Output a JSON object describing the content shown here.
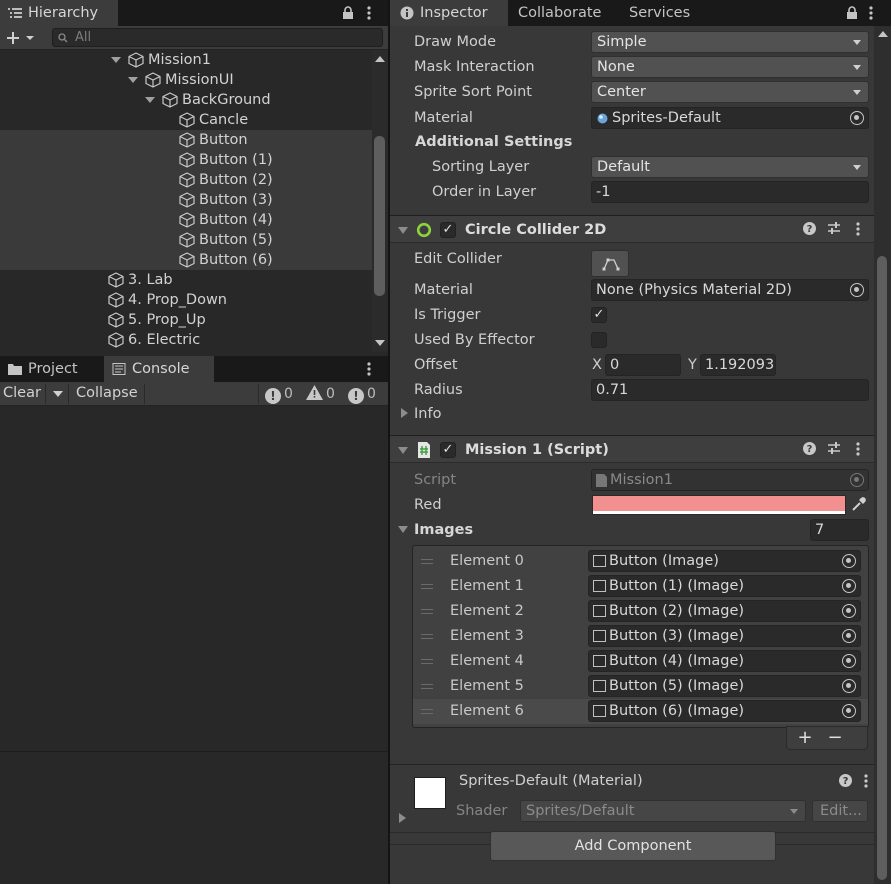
{
  "hierarchy": {
    "tab_label": "Hierarchy",
    "search_placeholder": "All",
    "items": [
      {
        "label": "Mission1",
        "depth": 0
      },
      {
        "label": "MissionUI",
        "depth": 1
      },
      {
        "label": "BackGround",
        "depth": 2
      },
      {
        "label": "Cancle",
        "depth": 3
      },
      {
        "label": "Button",
        "depth": 3
      },
      {
        "label": "Button (1)",
        "depth": 3
      },
      {
        "label": "Button (2)",
        "depth": 3
      },
      {
        "label": "Button (3)",
        "depth": 3
      },
      {
        "label": "Button (4)",
        "depth": 3
      },
      {
        "label": "Button (5)",
        "depth": 3
      },
      {
        "label": "Button (6)",
        "depth": 3
      },
      {
        "label": "3. Lab",
        "depth": -1
      },
      {
        "label": "4. Prop_Down",
        "depth": -1
      },
      {
        "label": "5. Prop_Up",
        "depth": -1
      },
      {
        "label": "6. Electric",
        "depth": -1
      }
    ]
  },
  "console": {
    "tabs": [
      "Project",
      "Console"
    ],
    "clear_label": "Clear",
    "collapse_label": "Collapse",
    "counts": {
      "info": "0",
      "warning": "0",
      "error": "0"
    }
  },
  "inspector": {
    "tabs": [
      "Inspector",
      "Collaborate",
      "Services"
    ],
    "sprite_renderer": {
      "draw_mode_label": "Draw Mode",
      "draw_mode": "Simple",
      "mask_label": "Mask Interaction",
      "mask": "None",
      "sort_point_label": "Sprite Sort Point",
      "sort_point": "Center",
      "material_label": "Material",
      "material": "Sprites-Default",
      "additional_label": "Additional Settings",
      "sorting_layer_label": "Sorting Layer",
      "sorting_layer": "Default",
      "order_label": "Order in Layer",
      "order": "-1"
    },
    "circle_collider": {
      "title": "Circle Collider 2D",
      "edit_label": "Edit Collider",
      "material_label": "Material",
      "material": "None (Physics Material 2D)",
      "trigger_label": "Is Trigger",
      "trigger_checked": true,
      "effector_label": "Used By Effector",
      "effector_checked": false,
      "offset_label": "Offset",
      "offset_x_label": "X",
      "offset_x": "0",
      "offset_y_label": "Y",
      "offset_y": "1.192093",
      "radius_label": "Radius",
      "radius": "0.71",
      "info_label": "Info"
    },
    "mission_script": {
      "title": "Mission 1 (Script)",
      "script_label": "Script",
      "script": "Mission1",
      "red_label": "Red",
      "red_color": "#f28f8f",
      "images_label": "Images",
      "images_count": "7",
      "elements": [
        {
          "label": "Element 0",
          "value": "Button (Image)"
        },
        {
          "label": "Element 1",
          "value": "Button (1) (Image)"
        },
        {
          "label": "Element 2",
          "value": "Button (2) (Image)"
        },
        {
          "label": "Element 3",
          "value": "Button (3) (Image)"
        },
        {
          "label": "Element 4",
          "value": "Button (4) (Image)"
        },
        {
          "label": "Element 5",
          "value": "Button (5) (Image)"
        },
        {
          "label": "Element 6",
          "value": "Button (6) (Image)"
        }
      ],
      "add_label": "+",
      "remove_label": "−"
    },
    "material_block": {
      "title": "Sprites-Default (Material)",
      "shader_label": "Shader",
      "shader": "Sprites/Default",
      "edit_label": "Edit..."
    },
    "add_component_label": "Add Component"
  },
  "colors": {
    "accent": "#8dd33b",
    "panel": "#383838",
    "selection": "#3a3a3a"
  }
}
